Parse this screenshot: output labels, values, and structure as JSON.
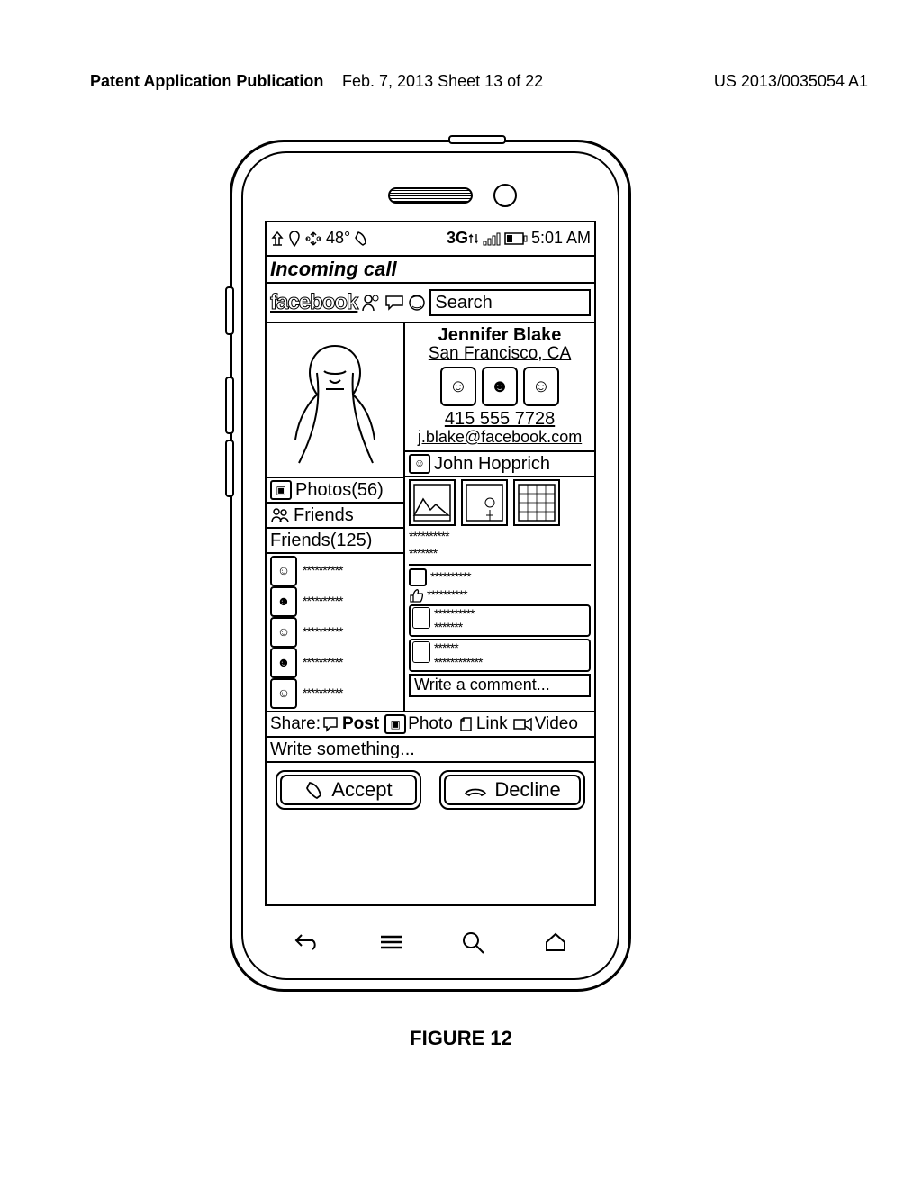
{
  "page_header": {
    "left": "Patent Application Publication",
    "mid": "Feb. 7, 2013  Sheet 13 of 22",
    "right": "US 2013/0035054 A1"
  },
  "status_bar": {
    "temp": "48°",
    "net": "3G",
    "time": "5:01 AM"
  },
  "incoming_label": "Incoming call",
  "fb": {
    "logo": "facebook",
    "search_label": "Search"
  },
  "profile": {
    "name": "Jennifer Blake",
    "location": "San Francisco, CA",
    "phone": "415 555 7728",
    "email": "j.blake@facebook.com"
  },
  "left_col": {
    "photos": "Photos(56)",
    "friends_tab": "Friends",
    "friends_header": "Friends(125)",
    "friend_rows": [
      "**********",
      "**********",
      "**********",
      "**********",
      "**********"
    ]
  },
  "right_col": {
    "post_author": "John Hopprich",
    "line0": "**********",
    "line1": "*******",
    "line_photo": "**********",
    "line_like": "**********",
    "c1a": "**********",
    "c1b": "*******",
    "c2a": "******",
    "c2b": "************",
    "comment_placeholder": "Write a comment..."
  },
  "share": {
    "label": "Share:",
    "post": "Post",
    "photo": "Photo",
    "link": "Link",
    "video": "Video"
  },
  "write_something": "Write something...",
  "call": {
    "accept": "Accept",
    "decline": "Decline"
  },
  "figure": "FIGURE 12"
}
